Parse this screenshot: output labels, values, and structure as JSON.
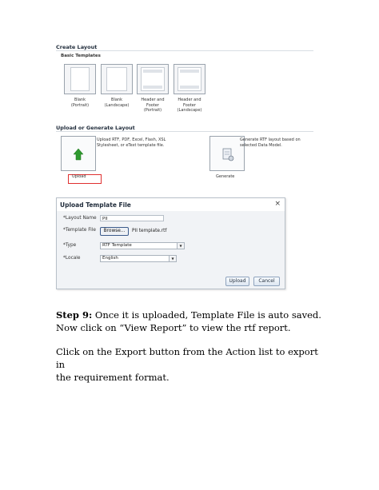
{
  "create_layout": {
    "title": "Create Layout",
    "basic_templates_title": "Basic Templates",
    "templates": [
      {
        "label_line1": "Blank",
        "label_line2": "(Portrait)",
        "icon": "blank-portrait-template-icon"
      },
      {
        "label_line1": "Blank",
        "label_line2": "(Landscape)",
        "icon": "blank-landscape-template-icon"
      },
      {
        "label_line1": "Header and",
        "label_line2": "Footer",
        "label_line3": "(Portrait)",
        "icon": "header-footer-portrait-template-icon"
      },
      {
        "label_line1": "Header and",
        "label_line2": "Footer",
        "label_line3": "(Landscape)",
        "icon": "header-footer-landscape-template-icon"
      }
    ]
  },
  "upload_generate": {
    "title": "Upload or Generate Layout",
    "upload_desc_line1": "Upload RTF, PDF, Excel, Flash, XSL",
    "upload_desc_line2": "Stylesheet, or eText template file.",
    "upload_label": "Upload",
    "generate_desc_line1": "Generate RTF layout based on",
    "generate_desc_line2": "selected Data Model.",
    "generate_label": "Generate",
    "upload_icon_color": "#2f9a2f"
  },
  "dialog": {
    "title": "Upload Template File",
    "close_glyph": "×",
    "layout_name_label": "*Layout Name",
    "layout_name_value": "PII",
    "template_file_label": "*Template File",
    "browse_label": "Browse...",
    "template_file_value": "PII template.rtf",
    "type_label": "*Type",
    "type_value": "RTF Template",
    "locale_label": "*Locale",
    "locale_value": "English",
    "upload_button": "Upload",
    "cancel_button": "Cancel"
  },
  "step": {
    "step_label": "Step 9:",
    "line1_rest": " Once it is uploaded, Template File is auto saved.",
    "line2": "Now click on “View Report” to view the rtf report."
  },
  "export_text": {
    "line1": "Click on the Export button from the Action list to export in",
    "line2": "the requirement format."
  }
}
